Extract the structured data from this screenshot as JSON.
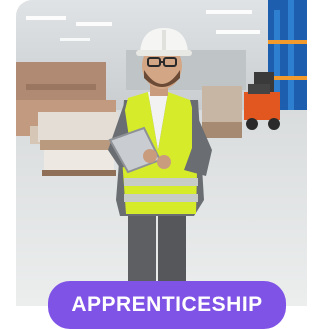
{
  "card": {
    "badge_label": "APPRENTICESHIP",
    "photo_subject": "warehouse-worker-with-tablet"
  },
  "colors": {
    "badge": "#7f53e6",
    "vest": "#d6ec2a",
    "helmet": "#f5f5f3",
    "forklift": "#e2571f",
    "racking": "#1d5fae"
  }
}
